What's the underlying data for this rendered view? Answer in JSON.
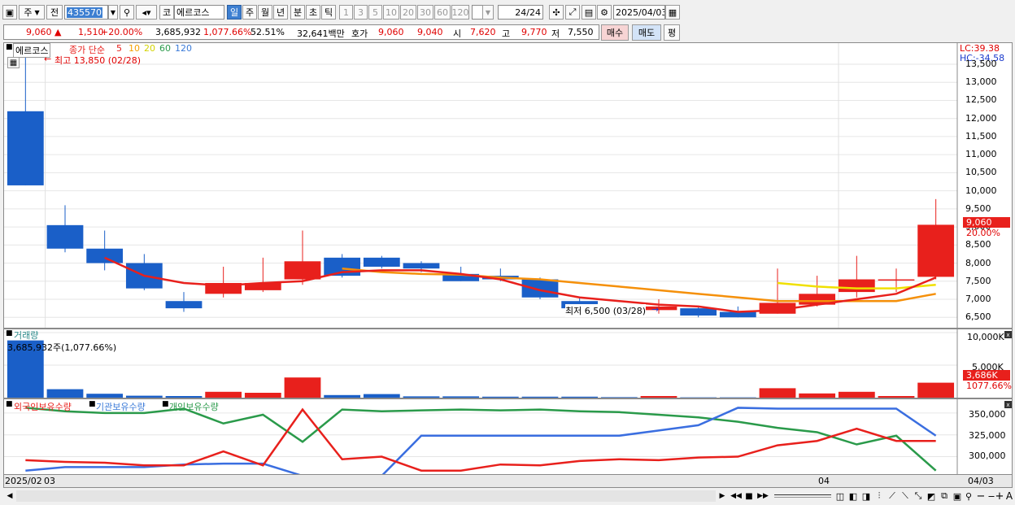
{
  "toolbar": {
    "market": "주",
    "prev": "전",
    "code": "435570",
    "market2": "코",
    "stock_name": "에르코스",
    "periods": [
      "일",
      "주",
      "월",
      "년",
      "분",
      "초",
      "틱"
    ],
    "intervals": [
      "1",
      "3",
      "5",
      "10",
      "20",
      "30",
      "60",
      "120"
    ],
    "page": "24/24",
    "date": "2025/04/03"
  },
  "quote": {
    "price": "9,060",
    "arrow": "▲",
    "change": "1,510",
    "change_pct": "+20.00%",
    "volume": "3,685,932",
    "vol_ratio": "1,077.66%",
    "rate": "52.51%",
    "amount": "32,641백만",
    "hoga_label": "호가",
    "ask": "9,060",
    "bid": "9,040",
    "open_label": "시",
    "open": "7,620",
    "high_label": "고",
    "high": "9,770",
    "low_label": "저",
    "low": "7,550",
    "buy": "매수",
    "sell": "매도",
    "eval": "평"
  },
  "price_panel": {
    "name_tag": "에르코스",
    "legend_title": "종가 단순",
    "ma_periods": [
      "5",
      "10",
      "20",
      "60",
      "120"
    ],
    "ma_colors": [
      "#e8201c",
      "#f5a000",
      "#e8e800",
      "#2a9a4a",
      "#3a7ad8"
    ],
    "high_note": "최고 13,850 (02/28)",
    "low_note": "최저 6,500 (03/28)",
    "lc": "LC:39.38",
    "hc": "HC:-34.58",
    "yticks": [
      "13,500",
      "13,000",
      "12,500",
      "12,000",
      "11,500",
      "11,000",
      "10,500",
      "10,000",
      "9,500",
      "9,000",
      "8,500",
      "8,000",
      "7,500",
      "7,000",
      "6,500"
    ],
    "current_price_tag": "9,060",
    "current_pct_tag": "20.00%"
  },
  "volume_panel": {
    "title": "거래량",
    "info": "3,685,932주(1,077.66%)",
    "yticks": [
      "10,000K",
      "5,000K"
    ],
    "current_tag": "3,686K",
    "current_pct": "1077.66%"
  },
  "holding_panel": {
    "legend": [
      "외국인보유수량",
      "기관보유수량",
      "개인보유수량"
    ],
    "legend_colors": [
      "#e8201c",
      "#3a7ad8",
      "#2a9a4a"
    ],
    "yticks": [
      "350,000",
      "325,000",
      "300,000"
    ]
  },
  "x_axis": {
    "start": "2025/02",
    "start_day": "03",
    "mid": "04",
    "end": "04/03"
  },
  "chart_data": {
    "type": "candlestick",
    "candles": [
      {
        "o": 12200,
        "h": 13850,
        "l": 10150,
        "c": 10150
      },
      {
        "o": 9050,
        "h": 9600,
        "l": 8300,
        "c": 8400
      },
      {
        "o": 8400,
        "h": 8900,
        "l": 7800,
        "c": 8000
      },
      {
        "o": 8000,
        "h": 8250,
        "l": 7250,
        "c": 7300
      },
      {
        "o": 6950,
        "h": 7200,
        "l": 6650,
        "c": 6750
      },
      {
        "o": 7150,
        "h": 7900,
        "l": 7050,
        "c": 7450
      },
      {
        "o": 7250,
        "h": 8150,
        "l": 7200,
        "c": 7450
      },
      {
        "o": 7550,
        "h": 8900,
        "l": 7400,
        "c": 8050
      },
      {
        "o": 8150,
        "h": 8250,
        "l": 7600,
        "c": 7650
      },
      {
        "o": 8150,
        "h": 8200,
        "l": 7850,
        "c": 7900
      },
      {
        "o": 8000,
        "h": 8050,
        "l": 7750,
        "c": 7850
      },
      {
        "o": 7700,
        "h": 7900,
        "l": 7500,
        "c": 7500
      },
      {
        "o": 7650,
        "h": 7850,
        "l": 7500,
        "c": 7550
      },
      {
        "o": 7550,
        "h": 7600,
        "l": 7000,
        "c": 7050
      },
      {
        "o": 6950,
        "h": 7050,
        "l": 6600,
        "c": 6750
      },
      {
        "o": 6750,
        "h": 6800,
        "l": 6500,
        "c": 6550
      },
      {
        "o": 6700,
        "h": 7000,
        "l": 6600,
        "c": 6800
      },
      {
        "o": 6750,
        "h": 6800,
        "l": 6500,
        "c": 6550
      },
      {
        "o": 6650,
        "h": 6800,
        "l": 6500,
        "c": 6500
      },
      {
        "o": 6600,
        "h": 7850,
        "l": 6600,
        "c": 6900
      },
      {
        "o": 6850,
        "h": 7650,
        "l": 6800,
        "c": 7150
      },
      {
        "o": 7200,
        "h": 8200,
        "l": 7050,
        "c": 7550
      },
      {
        "o": 7550,
        "h": 7850,
        "l": 7200,
        "c": 7550
      },
      {
        "o": 7620,
        "h": 9770,
        "l": 7550,
        "c": 9060
      }
    ],
    "ma5": [
      null,
      null,
      null,
      null,
      8150,
      7650,
      7450,
      7380,
      7450,
      7500,
      7750,
      7800,
      7800,
      7700,
      7550,
      7250,
      7050,
      6950,
      6850,
      6800,
      6650,
      6700,
      6850,
      7000,
      7150,
      7600
    ],
    "ma10": [
      null,
      null,
      null,
      null,
      null,
      null,
      null,
      null,
      null,
      7850,
      7750,
      7700,
      7680,
      7600,
      7550,
      7450,
      7350,
      7250,
      7150,
      7050,
      6950,
      6950,
      6950,
      6950,
      7150
    ],
    "ma20": [
      null,
      null,
      null,
      null,
      null,
      null,
      null,
      null,
      null,
      null,
      null,
      null,
      null,
      null,
      null,
      null,
      null,
      null,
      null,
      7450,
      7350,
      7300,
      7300,
      7400
    ],
    "volume_k": [
      8800,
      1300,
      600,
      300,
      250,
      900,
      750,
      3100,
      400,
      550,
      200,
      200,
      150,
      150,
      150,
      80,
      250,
      50,
      50,
      1450,
      650,
      900,
      250,
      2300
    ],
    "foreign": [
      296000,
      294000,
      293000,
      290000,
      290000,
      306000,
      290000,
      354000,
      297000,
      300000,
      284000,
      284000,
      291000,
      290000,
      295000,
      297000,
      296000,
      299000,
      300000,
      313000,
      318000,
      332000,
      318000,
      318000
    ],
    "institution": [
      284000,
      288000,
      288000,
      288000,
      291000,
      292000,
      292000,
      278000,
      278000,
      278000,
      324000,
      324000,
      324000,
      324000,
      324000,
      324000,
      330000,
      336000,
      356000,
      355000,
      355000,
      355000,
      355000,
      324000
    ],
    "individual": [
      356000,
      352000,
      350000,
      350000,
      355000,
      338000,
      348000,
      317000,
      354000,
      352000,
      353000,
      354000,
      353000,
      354000,
      352000,
      351000,
      348000,
      345000,
      340000,
      333000,
      328000,
      314000,
      324000,
      284000
    ]
  }
}
